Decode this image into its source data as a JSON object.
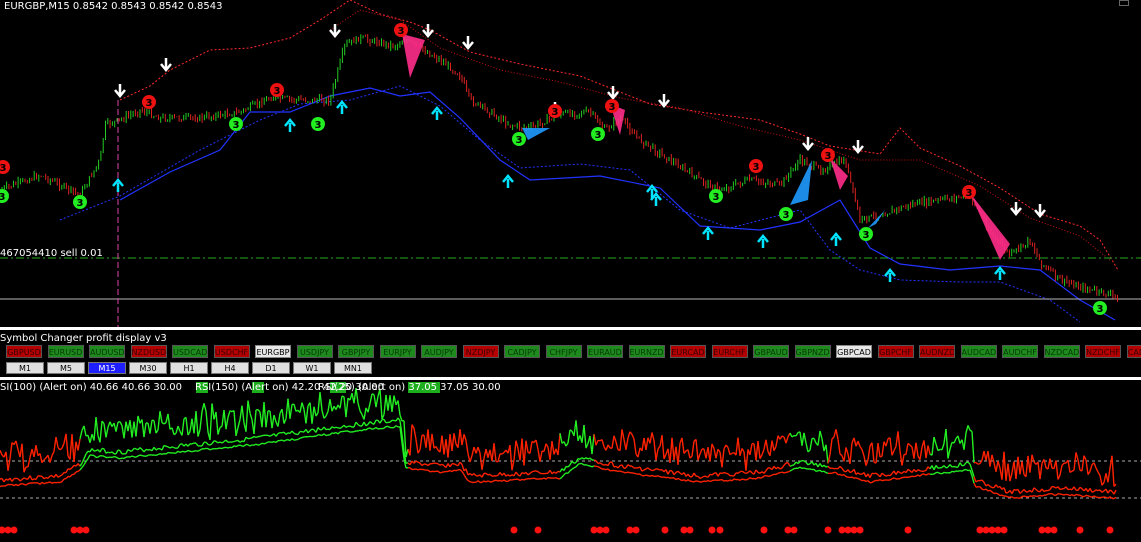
{
  "chart": {
    "header": "EURGBP,M15  0.8542 0.8543 0.8542 0.8543",
    "order_line_label": "467054410 sell 0.01",
    "colors": {
      "background": "#000000",
      "bull": "#22cc22",
      "bear": "#dd2222",
      "upper_band": "#ff2a2a",
      "lower_band": "#2233ff",
      "up_arrow": "#00e5ff",
      "down_arrow": "#ffffff",
      "fan_pink": "#ff2d8a",
      "fan_blue": "#1f9aff"
    },
    "badge_red_label": "3",
    "badge_green_label": "3",
    "arrow_icon_names": {
      "up": "up-arrow-icon",
      "down": "down-arrow-icon"
    }
  },
  "symbol_changer": {
    "title": "Symbol Changer profit display  v3",
    "pairs": [
      {
        "label": "GBPUSD",
        "state": "red"
      },
      {
        "label": "EURUSD",
        "state": "green"
      },
      {
        "label": "AUDUSD",
        "state": "green"
      },
      {
        "label": "NZDUSD",
        "state": "red"
      },
      {
        "label": "USDCAD",
        "state": "green"
      },
      {
        "label": "USDCHF",
        "state": "red"
      },
      {
        "label": "EURGBP",
        "state": "active"
      },
      {
        "label": "USDJPY",
        "state": "green"
      },
      {
        "label": "GBPJPY",
        "state": "green"
      },
      {
        "label": "EURJPY",
        "state": "green"
      },
      {
        "label": "AUDJPY",
        "state": "green"
      },
      {
        "label": "NZDJPY",
        "state": "red"
      },
      {
        "label": "CADJPY",
        "state": "green"
      },
      {
        "label": "CHFJPY",
        "state": "green"
      },
      {
        "label": "EURAUD",
        "state": "green"
      },
      {
        "label": "EURNZD",
        "state": "green"
      },
      {
        "label": "EURCAD",
        "state": "red"
      },
      {
        "label": "EURCHF",
        "state": "red"
      },
      {
        "label": "GBPAUD",
        "state": "green"
      },
      {
        "label": "GBPNZD",
        "state": "green"
      },
      {
        "label": "GBPCAD",
        "state": "active"
      },
      {
        "label": "GBPCHF",
        "state": "red"
      },
      {
        "label": "AUDNZD",
        "state": "red"
      },
      {
        "label": "AUDCAD",
        "state": "green"
      },
      {
        "label": "AUDCHF",
        "state": "green"
      },
      {
        "label": "NZDCAD",
        "state": "green"
      },
      {
        "label": "NZDCHF",
        "state": "red"
      },
      {
        "label": "CADCHF",
        "state": "red"
      }
    ],
    "timeframes": [
      {
        "label": "M1",
        "active": false
      },
      {
        "label": "M5",
        "active": false
      },
      {
        "label": "M15",
        "active": true
      },
      {
        "label": "M30",
        "active": false
      },
      {
        "label": "H1",
        "active": false
      },
      {
        "label": "H4",
        "active": false
      },
      {
        "label": "D1",
        "active": false
      },
      {
        "label": "W1",
        "active": false
      },
      {
        "label": "MN1",
        "active": false
      }
    ]
  },
  "rsi_panel": {
    "header_1": "SI(100) (Alert on) 40.66 40.66 30.00",
    "header_2": "RSI(150) (Alert on) 42.20 42.20 30.00",
    "header_3": "RSI(25) (Alert on) 37.05 37.05 30.00",
    "colors": {
      "bull": "#22ee22",
      "bear": "#ff2200",
      "dots": "#ff1111"
    }
  }
}
